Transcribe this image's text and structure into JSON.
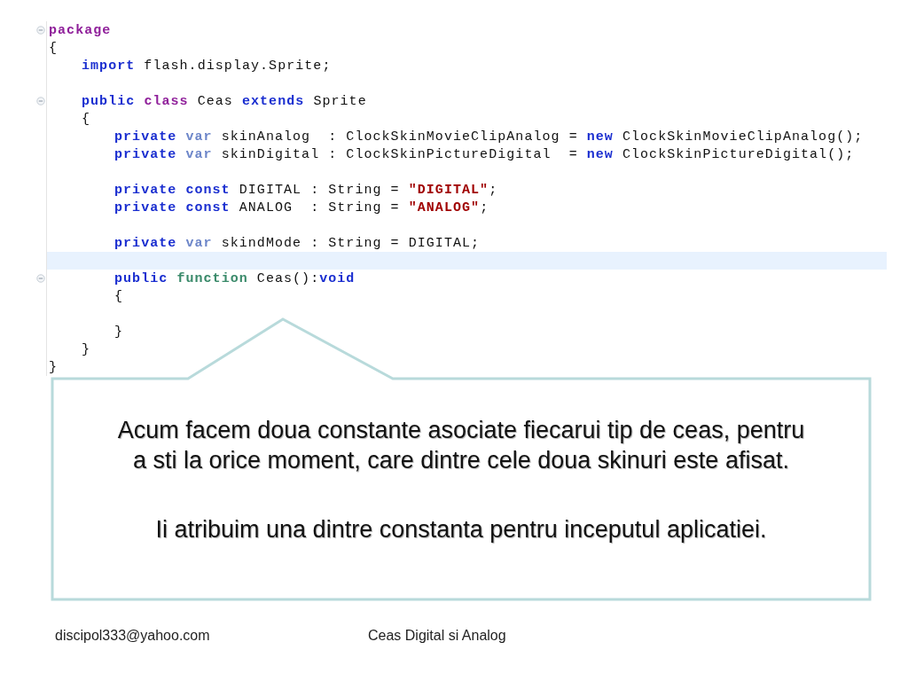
{
  "code_editor": {
    "lines": [
      {
        "fold": true,
        "highlighted": false,
        "tokens": [
          {
            "kind": "type",
            "t": "package"
          }
        ]
      },
      {
        "fold": false,
        "highlighted": false,
        "tokens": [
          {
            "kind": "plain",
            "t": "{"
          }
        ],
        "children": [
          {
            "fold": false,
            "highlighted": false,
            "tokens": [
              {
                "kind": "keyword",
                "t": "import"
              },
              {
                "kind": "plain",
                "t": " flash.display.Sprite;"
              }
            ]
          },
          {
            "fold": false,
            "highlighted": false
          },
          {
            "fold": true,
            "highlighted": false,
            "tokens": [
              {
                "kind": "keyword",
                "t": "public "
              },
              {
                "kind": "type",
                "t": "class"
              },
              {
                "kind": "plain",
                "t": " Ceas "
              },
              {
                "kind": "keyword",
                "t": "extends"
              },
              {
                "kind": "plain",
                "t": " Sprite"
              }
            ]
          },
          {
            "fold": false,
            "highlighted": false,
            "tokens": [
              {
                "kind": "plain",
                "t": "{"
              }
            ],
            "children": [
              {
                "fold": false,
                "highlighted": false,
                "tokens": [
                  {
                    "kind": "keyword",
                    "t": "private "
                  },
                  {
                    "kind": "decl",
                    "t": "var"
                  },
                  {
                    "kind": "plain",
                    "t": " skinAnalog  : ClockSkinMovieClipAnalog = "
                  },
                  {
                    "kind": "keyword",
                    "t": "new"
                  },
                  {
                    "kind": "plain",
                    "t": " ClockSkinMovieClipAnalog();"
                  }
                ]
              },
              {
                "fold": false,
                "highlighted": false,
                "tokens": [
                  {
                    "kind": "keyword",
                    "t": "private "
                  },
                  {
                    "kind": "decl",
                    "t": "var"
                  },
                  {
                    "kind": "plain",
                    "t": " skinDigital : ClockSkinPictureDigital  = "
                  },
                  {
                    "kind": "keyword",
                    "t": "new"
                  },
                  {
                    "kind": "plain",
                    "t": " ClockSkinPictureDigital();"
                  }
                ]
              },
              {
                "fold": false,
                "highlighted": false
              },
              {
                "fold": false,
                "highlighted": false,
                "tokens": [
                  {
                    "kind": "keyword",
                    "t": "private const"
                  },
                  {
                    "kind": "plain",
                    "t": " DIGITAL : String = "
                  },
                  {
                    "kind": "string",
                    "t": "\"DIGITAL\""
                  },
                  {
                    "kind": "plain",
                    "t": ";"
                  }
                ]
              },
              {
                "fold": false,
                "highlighted": false,
                "tokens": [
                  {
                    "kind": "keyword",
                    "t": "private const"
                  },
                  {
                    "kind": "plain",
                    "t": " ANALOG  : String = "
                  },
                  {
                    "kind": "string",
                    "t": "\"ANALOG\""
                  },
                  {
                    "kind": "plain",
                    "t": ";"
                  }
                ]
              },
              {
                "fold": false,
                "highlighted": false
              },
              {
                "fold": false,
                "highlighted": false,
                "tokens": [
                  {
                    "kind": "keyword",
                    "t": "private "
                  },
                  {
                    "kind": "decl",
                    "t": "var"
                  },
                  {
                    "kind": "plain",
                    "t": " skindMode : String = DIGITAL;"
                  }
                ]
              },
              {
                "fold": false,
                "highlighted": true
              },
              {
                "fold": true,
                "highlighted": false,
                "tokens": [
                  {
                    "kind": "keyword",
                    "t": "public "
                  },
                  {
                    "kind": "function",
                    "t": "function"
                  },
                  {
                    "kind": "plain",
                    "t": " Ceas():"
                  },
                  {
                    "kind": "keyword",
                    "t": "void"
                  }
                ]
              },
              {
                "fold": false,
                "highlighted": false,
                "tokens": [
                  {
                    "kind": "plain",
                    "t": "{"
                  }
                ],
                "children": [
                  {
                    "fold": false,
                    "highlighted": false
                  }
                ]
              },
              {
                "fold": false,
                "highlighted": false,
                "tokens": [
                  {
                    "kind": "plain",
                    "t": "}"
                  }
                ]
              }
            ]
          },
          {
            "fold": false,
            "highlighted": false,
            "tokens": [
              {
                "kind": "plain",
                "t": "}"
              }
            ]
          }
        ]
      },
      {
        "fold": false,
        "highlighted": false,
        "tokens": [
          {
            "kind": "plain",
            "t": "}"
          }
        ]
      }
    ]
  },
  "callout": {
    "paragraphs": [
      "Acum facem doua constante asociate fiecarui tip de ceas, pentru a sti la orice moment, care dintre cele doua skinuri este afisat.",
      "Ii atribuim una dintre constanta pentru inceputul aplicatiei."
    ]
  },
  "footer": {
    "email": "discipol333@yahoo.com",
    "title": "Ceas Digital si Analog"
  }
}
